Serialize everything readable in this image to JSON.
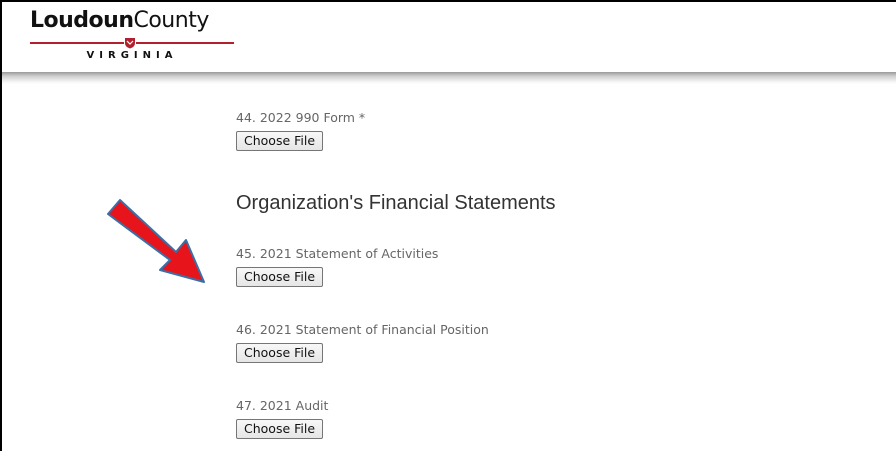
{
  "header": {
    "logo_bold": "Loudoun",
    "logo_light": "County",
    "logo_sub": "VIRGINIA"
  },
  "form": {
    "fields": [
      {
        "label": "44. 2022 990 Form *",
        "button": "Choose File"
      },
      {
        "label": "45. 2021 Statement of Activities",
        "button": "Choose File"
      },
      {
        "label": "46. 2021 Statement of Financial Position",
        "button": "Choose File"
      },
      {
        "label": "47. 2021 Audit",
        "button": "Choose File"
      }
    ],
    "section_title": "Organization's Financial Statements"
  },
  "annotation": {
    "arrow_color": "#e8141b",
    "arrow_outline": "#3a6fa8",
    "icon": "red-arrow-icon"
  }
}
